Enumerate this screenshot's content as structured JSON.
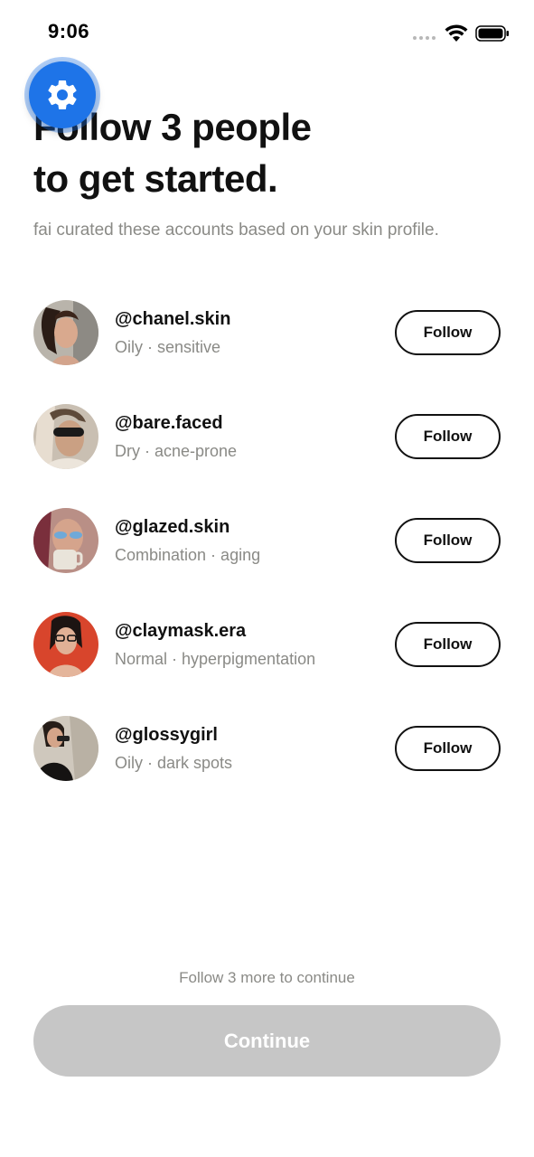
{
  "status_bar": {
    "time": "9:06",
    "icons": [
      "signal-dots-icon",
      "wifi-icon",
      "battery-icon"
    ]
  },
  "settings_button": {
    "icon": "gear-icon",
    "color": "#1e74e8"
  },
  "header": {
    "title_line1": "Follow 3 people",
    "title_line2": "to get started.",
    "subtitle": "fai curated these accounts based on your skin profile."
  },
  "accounts": [
    {
      "handle": "@chanel.skin",
      "skin_type": "Oily · sensitive",
      "follow_label": "Follow"
    },
    {
      "handle": "@bare.faced",
      "skin_type": "Dry · acne-prone",
      "follow_label": "Follow"
    },
    {
      "handle": "@glazed.skin",
      "skin_type": "Combination · aging",
      "follow_label": "Follow"
    },
    {
      "handle": "@claymask.era",
      "skin_type": "Normal · hyperpigmentation",
      "follow_label": "Follow"
    },
    {
      "handle": "@glossygirl",
      "skin_type": "Oily · dark spots",
      "follow_label": "Follow"
    }
  ],
  "footer": {
    "hint": "Follow 3 more to continue",
    "continue_label": "Continue",
    "continue_color": "#c6c6c6"
  }
}
